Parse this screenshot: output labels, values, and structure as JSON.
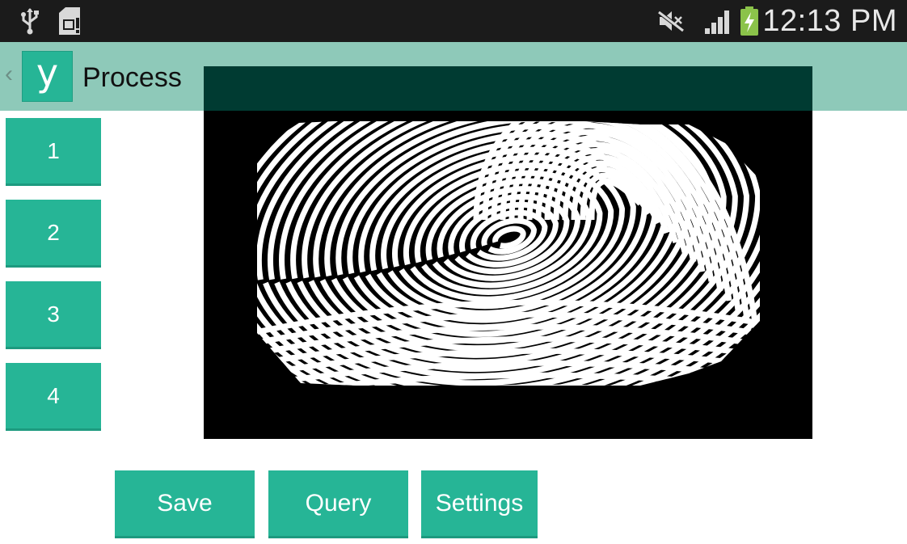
{
  "status_bar": {
    "time": "12:13 PM",
    "icons": [
      "usb-icon",
      "sd-card-icon",
      "mute-icon",
      "signal-icon",
      "battery-charging-icon"
    ]
  },
  "action_bar": {
    "up_caret": "‹",
    "logo_letter": "y",
    "title": "Process"
  },
  "side_buttons": [
    "1",
    "2",
    "3",
    "4"
  ],
  "bottom_buttons": {
    "save": "Save",
    "query": "Query",
    "settings": "Settings"
  },
  "colors": {
    "accent": "#26b596",
    "action_bar": "#8ec9b9",
    "status_bar": "#1b1b1b"
  }
}
